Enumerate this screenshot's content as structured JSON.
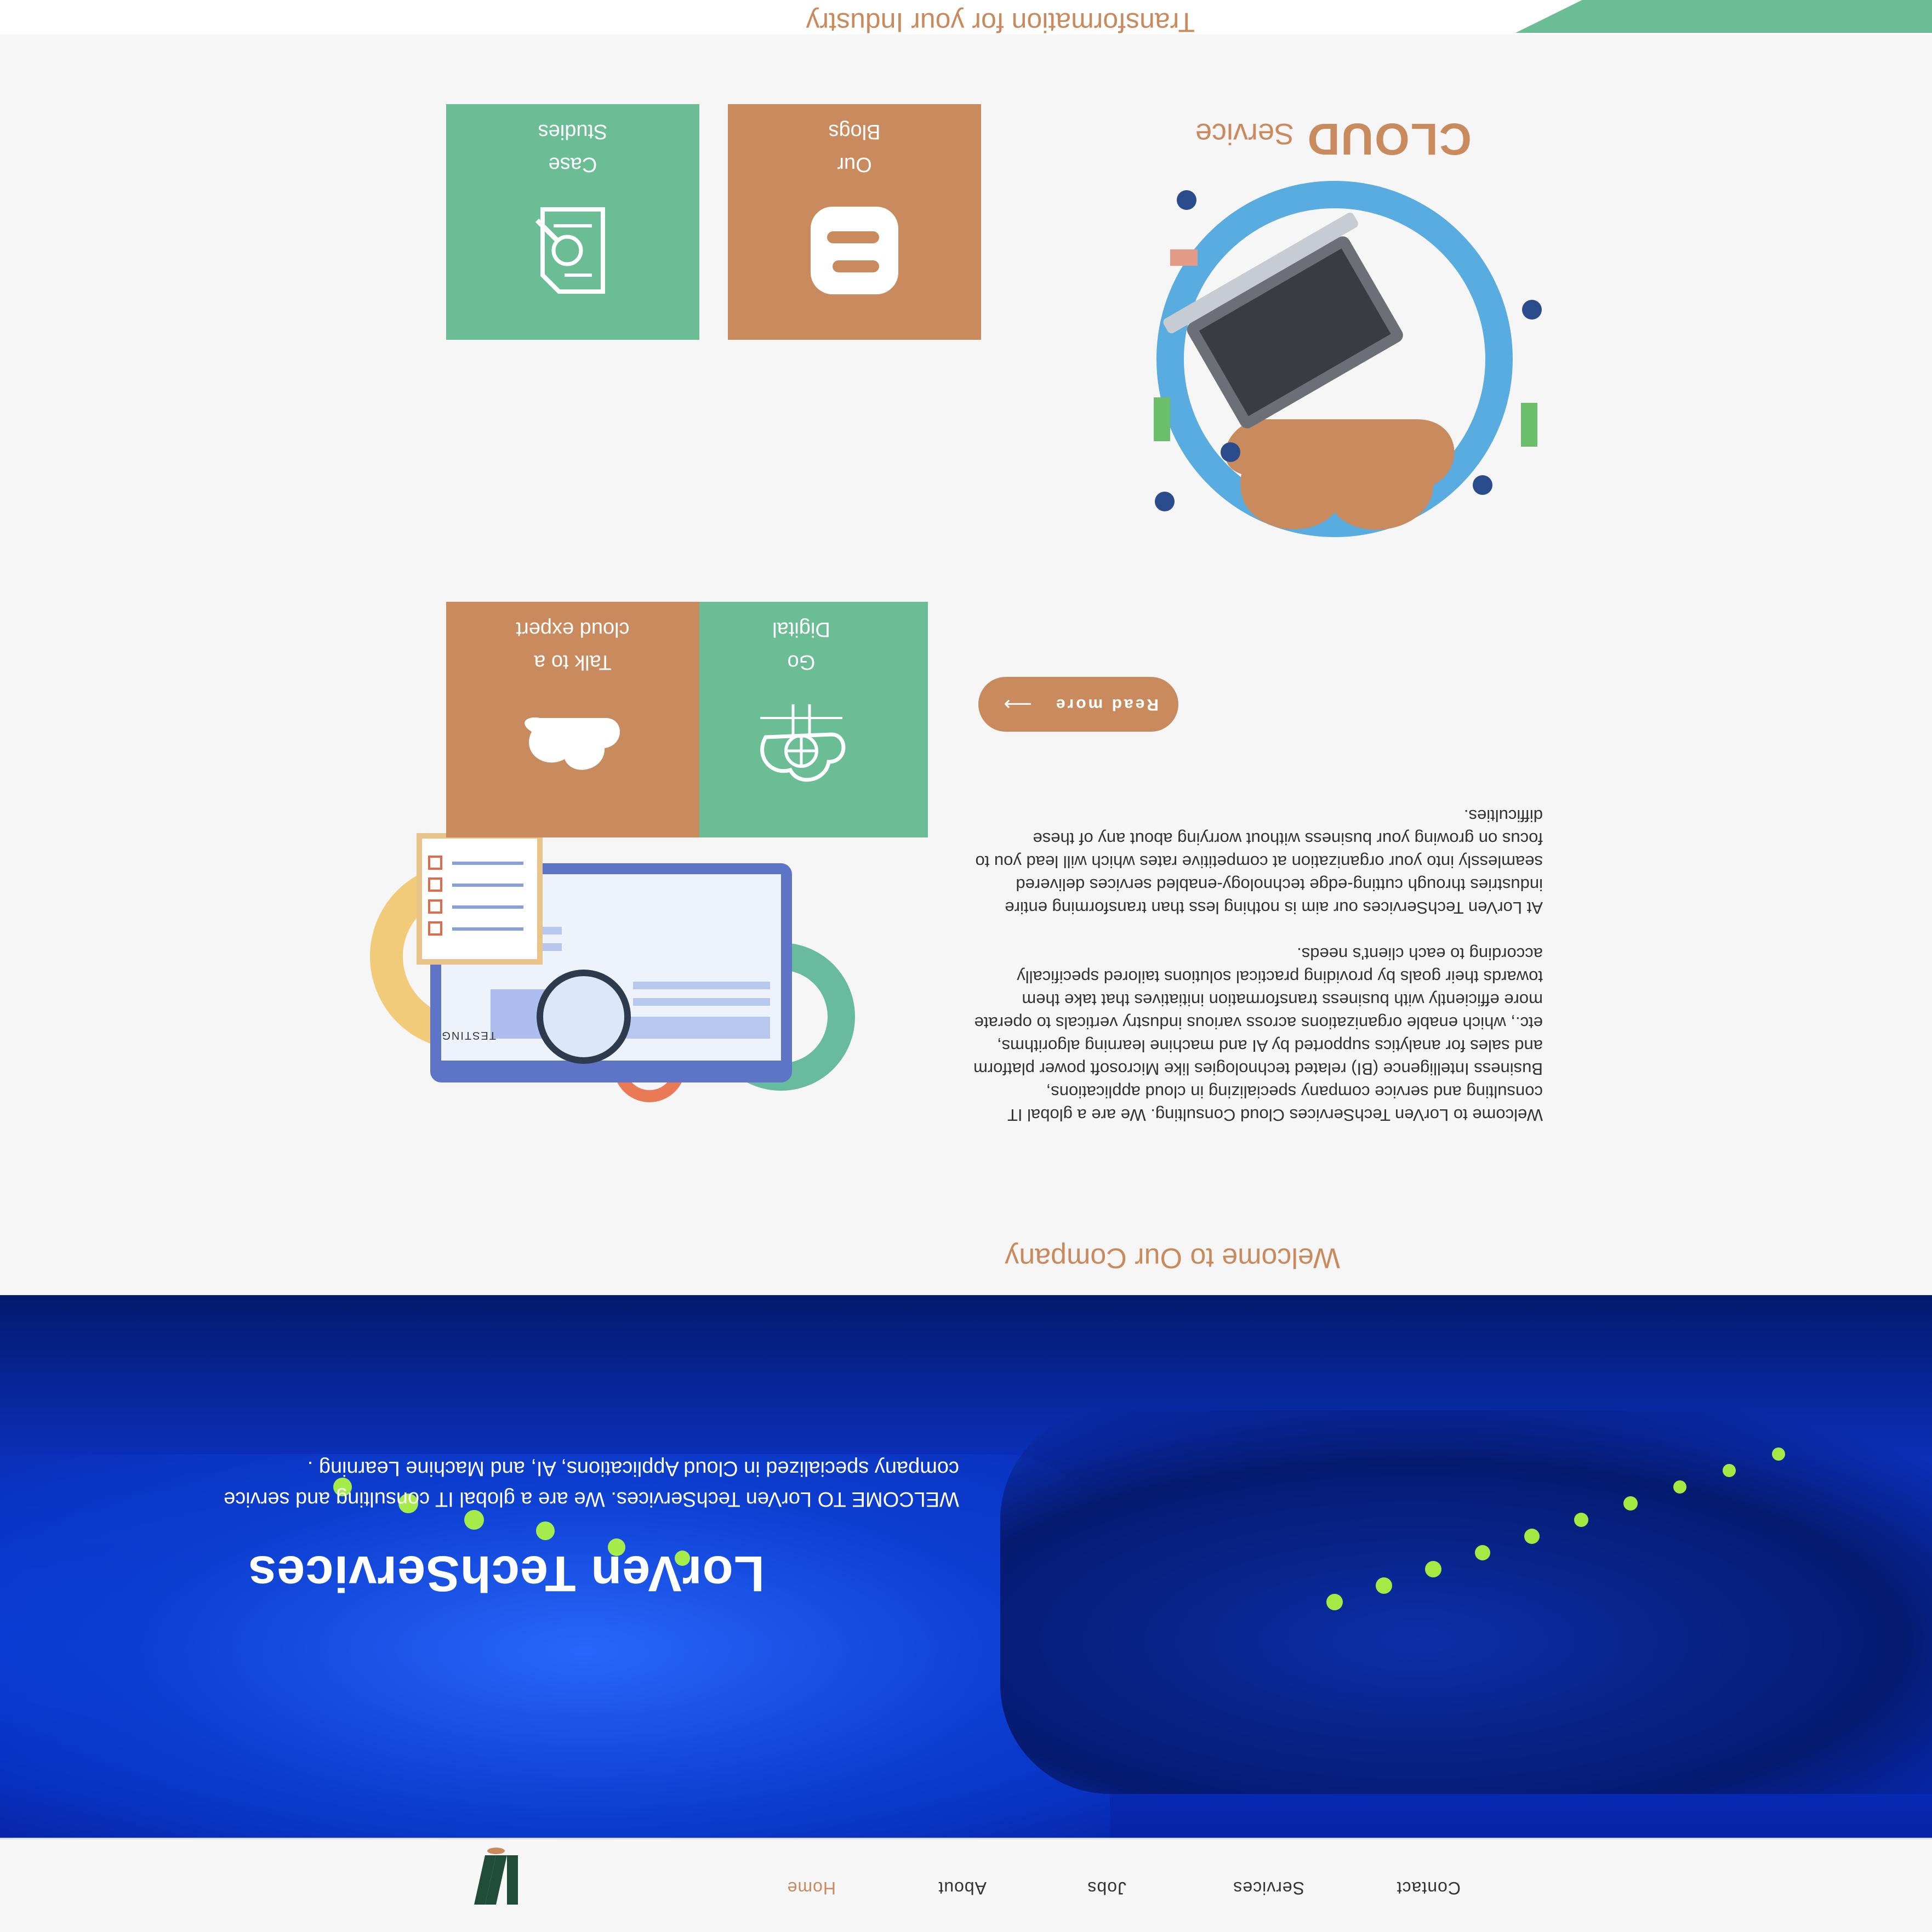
{
  "nav": {
    "items": [
      {
        "label": "Home",
        "active": true
      },
      {
        "label": "About",
        "active": false
      },
      {
        "label": "Jobs",
        "active": false
      },
      {
        "label": "Services",
        "active": false
      },
      {
        "label": "Contact",
        "active": false
      }
    ],
    "logo_text": "LV"
  },
  "hero": {
    "title": "LorVen TechServices",
    "subtitle": "WELCOME TO LorVen TechServices. We are a global IT consulting and service company specialized in Cloud Applications, AI, and Machine Learning ."
  },
  "welcome": {
    "heading": "Welcome to Our Company",
    "paragraph1": "Welcome to LorVen TechServices Cloud Consulting. We are a global IT consulting and service company specializing in cloud applications, Business Intelligence (BI) related technologies like Microsoft power platform and sales for analytics supported by AI and machine learning algorithms, etc., which enable organizations across various industry verticals to operate more efficiently with business transformation initiatives that take them towards their goals by providing practical solutions tailored specifically according to each client's needs.",
    "paragraph2": "At LorVen TechServices our aim is nothing less than transforming entire industries through cutting-edge technology-enabled services delivered seamlessly into your organization at competitive rates which will lead you to focus on growing your business without worrying about any of these difficulties.",
    "read_more": "Read more",
    "testing_label": "TESTING"
  },
  "cloud": {
    "heading_big": "CLOUD",
    "heading_small": "Service"
  },
  "tiles": [
    {
      "line1": "Go",
      "line2": "Digital",
      "color": "green",
      "icon": "cloud-globe-icon"
    },
    {
      "line1": "Talk to a",
      "line2": "cloud expert",
      "color": "orange",
      "icon": "cloud-icon"
    },
    {
      "line1": "Our",
      "line2": "Blogs",
      "color": "orange",
      "icon": "blogger-icon"
    },
    {
      "line1": "Case",
      "line2": "Studies",
      "color": "green",
      "icon": "document-search-icon"
    }
  ],
  "footer_strip": {
    "text": "Transformation for your Industry"
  },
  "colors": {
    "accent_orange": "#c98a5d",
    "accent_green": "#6bbd95",
    "hero_blue": "#0737d6"
  }
}
